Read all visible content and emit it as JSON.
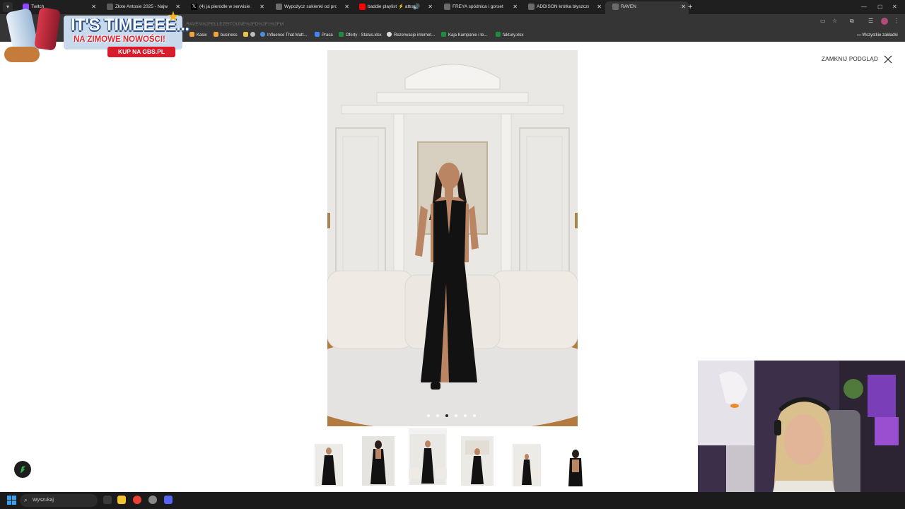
{
  "browser": {
    "tabs": [
      {
        "title": "Twitch",
        "favicon_color": "#9146ff",
        "active": false
      },
      {
        "title": "Złote Antosie 2025 - Najwięks",
        "favicon_color": "#5a5a5a",
        "active": false
      },
      {
        "title": "(4) ja pierodle w serwisie X: „Ja",
        "favicon_color": "#000000",
        "active": false
      },
      {
        "title": "Wypożycz sukienki od projekta",
        "favicon_color": "#6b6b6b",
        "active": false
      },
      {
        "title": "baddie playlist ⚡ attractive",
        "favicon_color": "#ff0000",
        "active": false
      },
      {
        "title": "FREYA spódnica i gorset z celi",
        "favicon_color": "#6b6b6b",
        "active": false
      },
      {
        "title": "ADDISON krótka błyszcząca su",
        "favicon_color": "#6b6b6b",
        "active": false
      },
      {
        "title": "RAVEN",
        "favicon_color": "#6b6b6b",
        "active": true
      }
    ],
    "url": "...RAVEN%2FELLEZEITOUNE%2FD%2F1%2FM",
    "bookmarks": [
      {
        "label": "Kasix",
        "color": "#f0a43a"
      },
      {
        "label": "business",
        "color": "#f0a43a"
      },
      {
        "label": "(ikona)",
        "color": "#e8c34a"
      },
      {
        "label": "Influence That Matt...",
        "color": "#4a90e2"
      },
      {
        "label": "Praca",
        "color": "#4285f4"
      },
      {
        "label": "Oferty - Status.xlsx",
        "color": "#1e8e3e"
      },
      {
        "label": "Rezerwacje internet...",
        "color": "#dddddd"
      },
      {
        "label": "Kaja Kampanie i te...",
        "color": "#1e8e3e"
      },
      {
        "label": "faktury.xlsx",
        "color": "#1e8e3e"
      }
    ],
    "bookmarks_all": "Wszystkie zakładki"
  },
  "ad": {
    "headline": "IT'S TIMEEEE...",
    "subline": "NA ZIMOWE NOWOŚCI!",
    "cta": "KUP NA GBS.PL"
  },
  "viewer": {
    "close_label": "ZAMKNIJ PODGLĄD",
    "slide_count": 6,
    "active_slide": 3,
    "thumbnail_count": 6
  },
  "taskbar": {
    "search_placeholder": "Wyszukaj"
  },
  "colors": {
    "chrome_dark": "#1f1f1f",
    "toolbar": "#353535",
    "accent_green": "#2fb24a",
    "dress_black": "#121212"
  }
}
